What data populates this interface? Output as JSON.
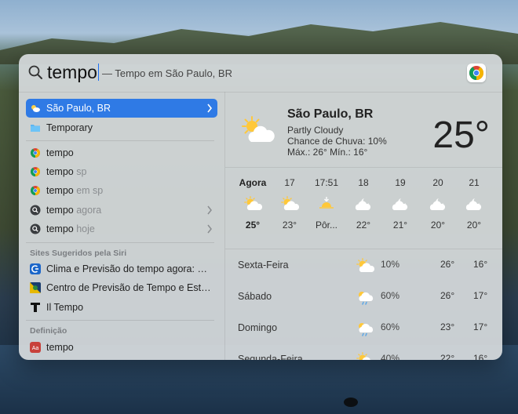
{
  "search": {
    "query": "tempo",
    "suggestion": "— Tempo em São Paulo, BR"
  },
  "results": [
    {
      "label": "São Paulo, BR",
      "rest": "",
      "icon": "weather-icon",
      "selected": true,
      "chevron": true
    },
    {
      "label": "Temporary",
      "rest": "",
      "icon": "folder-icon"
    },
    {
      "label": "tempo",
      "rest": "",
      "icon": "chrome-icon"
    },
    {
      "label": "tempo",
      "rest": " sp",
      "icon": "chrome-icon"
    },
    {
      "label": "tempo",
      "rest": " em sp",
      "icon": "chrome-icon"
    },
    {
      "label": "tempo",
      "rest": " agora",
      "icon": "search-icon",
      "chevron": true
    },
    {
      "label": "tempo",
      "rest": " hoje",
      "icon": "search-icon",
      "chevron": true
    }
  ],
  "siri": {
    "heading": "Sites Sugeridos pela Siri",
    "items": [
      {
        "label": "Clima e Previsão do tempo agora: Met...",
        "icon": "climatempo-icon"
      },
      {
        "label": "Centro de Previsão de Tempo e Estud...",
        "icon": "cptec-icon"
      },
      {
        "label": "Il Tempo",
        "icon": "il-tempo-icon"
      }
    ]
  },
  "definition": {
    "heading": "Definição",
    "item": "tempo",
    "icon": "dictionary-icon"
  },
  "weather": {
    "city": "São Paulo, BR",
    "condition": "Partly Cloudy",
    "rain": "Chance de Chuva: 10%",
    "range": "Máx.: 26° Mín.: 16°",
    "temp": "25°",
    "hourly": [
      {
        "time": "Agora",
        "temp": "25°",
        "icon": "partly-cloudy-icon"
      },
      {
        "time": "17",
        "temp": "23°",
        "icon": "partly-cloudy-icon"
      },
      {
        "time": "17:51",
        "temp": "Pôr...",
        "icon": "sunset-icon"
      },
      {
        "time": "18",
        "temp": "22°",
        "icon": "night-cloudy-icon"
      },
      {
        "time": "19",
        "temp": "21°",
        "icon": "night-cloudy-icon"
      },
      {
        "time": "20",
        "temp": "20°",
        "icon": "night-cloudy-icon"
      },
      {
        "time": "21",
        "temp": "20°",
        "icon": "night-cloudy-icon"
      }
    ],
    "daily": [
      {
        "day": "Sexta-Feira",
        "pop": "10%",
        "hi": "26°",
        "lo": "16°",
        "icon": "partly-cloudy-icon"
      },
      {
        "day": "Sábado",
        "pop": "60%",
        "hi": "26°",
        "lo": "17°",
        "icon": "rain-icon"
      },
      {
        "day": "Domingo",
        "pop": "60%",
        "hi": "23°",
        "lo": "17°",
        "icon": "rain-icon"
      },
      {
        "day": "Segunda-Feira",
        "pop": "40%",
        "hi": "22°",
        "lo": "16°",
        "icon": "partly-cloudy-icon"
      }
    ]
  },
  "colors": {
    "selection": "#2f7ae5",
    "caret": "#1c6ff5"
  }
}
